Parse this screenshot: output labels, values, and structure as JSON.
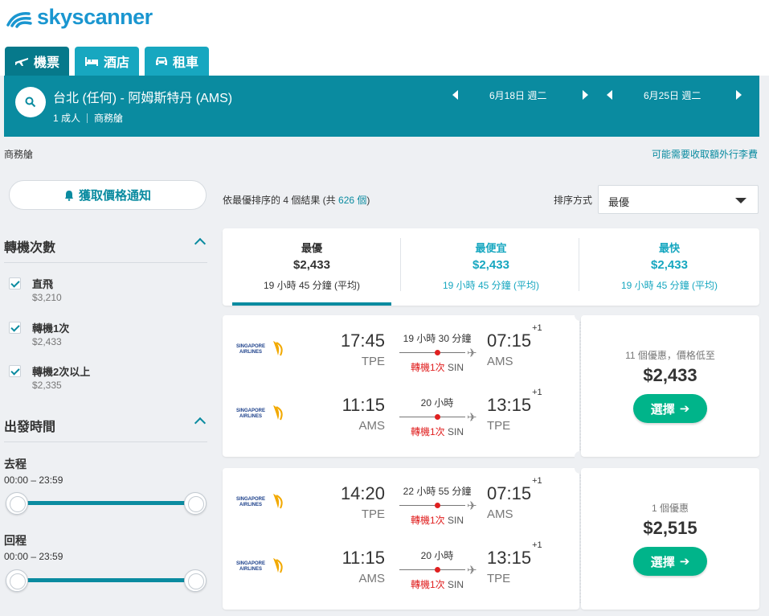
{
  "brand": {
    "name": "skyscanner",
    "color": "#1a96d0"
  },
  "tabs": [
    {
      "label": "機票",
      "icon": "plane-icon",
      "active": true
    },
    {
      "label": "酒店",
      "icon": "bed-icon",
      "active": false
    },
    {
      "label": "租車",
      "icon": "car-icon",
      "active": false
    }
  ],
  "search": {
    "route": "台北 (任何) - 阿姆斯特丹 (AMS)",
    "passengers": "1 成人",
    "cabin": "商務艙",
    "outbound_date": "6月18日 週二",
    "return_date": "6月25日 週二"
  },
  "subheader": {
    "cabin_label": "商務艙",
    "fee_notice": "可能需要收取額外行李費"
  },
  "sidebar": {
    "price_alert_label": "獲取價格通知",
    "stops_title": "轉機次數",
    "stops": [
      {
        "label": "直飛",
        "price": "$3,210",
        "checked": true
      },
      {
        "label": "轉機1次",
        "price": "$2,433",
        "checked": true
      },
      {
        "label": "轉機2次以上",
        "price": "$2,335",
        "checked": true
      }
    ],
    "departure_title": "出發時間",
    "outbound_label": "去程",
    "outbound_range": "00:00 – 23:59",
    "return_label": "回程",
    "return_range": "00:00 – 23:59"
  },
  "results": {
    "summary_prefix": "依最優排序的 4 個結果 (共 ",
    "total": "626 個",
    "summary_suffix": ")",
    "sort_label": "排序方式",
    "sort_value": "最優"
  },
  "sort_tabs": [
    {
      "title": "最優",
      "price": "$2,433",
      "duration": "19 小時 45 分鐘 (平均)"
    },
    {
      "title": "最便宜",
      "price": "$2,433",
      "duration": "19 小時 45 分鐘 (平均)"
    },
    {
      "title": "最快",
      "price": "$2,433",
      "duration": "19 小時 45 分鐘 (平均)"
    }
  ],
  "itineraries": [
    {
      "legs": [
        {
          "airline": "SINGAPORE AIRLINES",
          "dep_time": "17:45",
          "dep_code": "TPE",
          "arr_time": "07:15",
          "arr_offset": "+1",
          "arr_code": "AMS",
          "duration": "19 小時 30 分鐘",
          "stops": "轉機1次",
          "via": "SIN"
        },
        {
          "airline": "SINGAPORE AIRLINES",
          "dep_time": "11:15",
          "dep_code": "AMS",
          "arr_time": "13:15",
          "arr_offset": "+1",
          "arr_code": "TPE",
          "duration": "20 小時",
          "stops": "轉機1次",
          "via": "SIN"
        }
      ],
      "deals": "11 個優惠，價格低至",
      "price": "$2,433",
      "select_label": "選擇"
    },
    {
      "legs": [
        {
          "airline": "SINGAPORE AIRLINES",
          "dep_time": "14:20",
          "dep_code": "TPE",
          "arr_time": "07:15",
          "arr_offset": "+1",
          "arr_code": "AMS",
          "duration": "22 小時 55 分鐘",
          "stops": "轉機1次",
          "via": "SIN"
        },
        {
          "airline": "SINGAPORE AIRLINES",
          "dep_time": "11:15",
          "dep_code": "AMS",
          "arr_time": "13:15",
          "arr_offset": "+1",
          "arr_code": "TPE",
          "duration": "20 小時",
          "stops": "轉機1次",
          "via": "SIN"
        }
      ],
      "deals": "1 個優惠",
      "price": "$2,515",
      "select_label": "選擇"
    }
  ]
}
